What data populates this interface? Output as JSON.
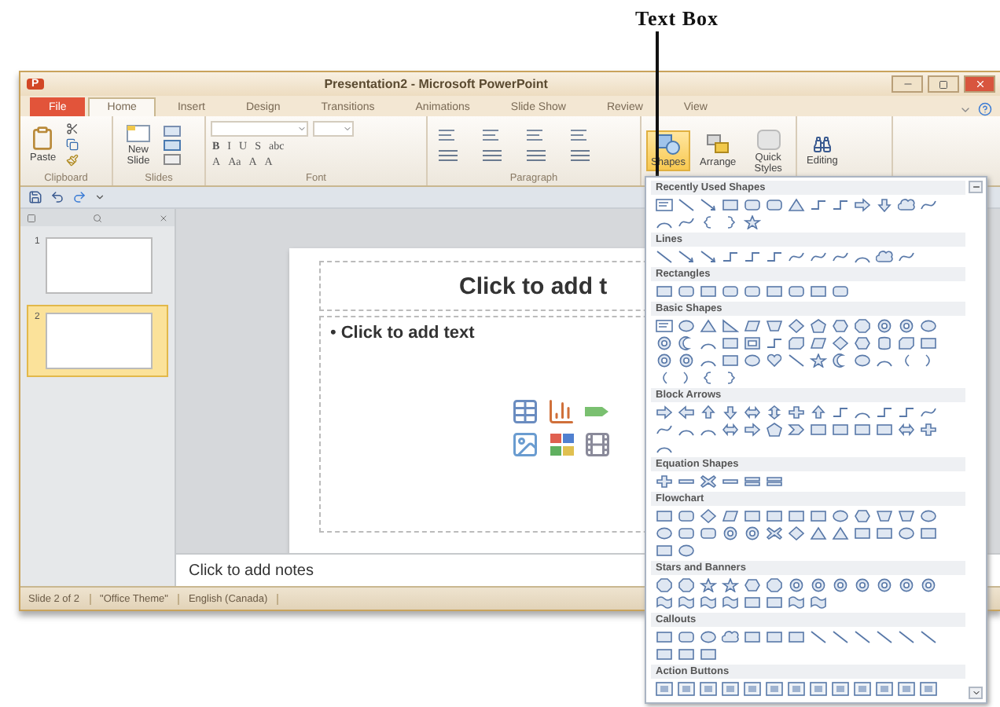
{
  "annotation": {
    "label": "Text Box"
  },
  "window": {
    "app_icon": "P",
    "title": "Presentation2 - Microsoft PowerPoint"
  },
  "tabs": [
    {
      "label": "File",
      "kind": "file",
      "selected": false
    },
    {
      "label": "Home",
      "kind": "tab",
      "selected": true
    },
    {
      "label": "Insert",
      "kind": "tab",
      "selected": false
    },
    {
      "label": "Design",
      "kind": "tab",
      "selected": false
    },
    {
      "label": "Transitions",
      "kind": "tab",
      "selected": false
    },
    {
      "label": "Animations",
      "kind": "tab",
      "selected": false
    },
    {
      "label": "Slide Show",
      "kind": "tab",
      "selected": false
    },
    {
      "label": "Review",
      "kind": "tab",
      "selected": false
    },
    {
      "label": "View",
      "kind": "tab",
      "selected": false
    }
  ],
  "ribbon": {
    "clipboard": {
      "label": "Clipboard",
      "paste": "Paste"
    },
    "slides": {
      "label": "Slides",
      "new_slide": "New Slide"
    },
    "font": {
      "label": "Font",
      "row1": [
        "B",
        "I",
        "U",
        "S",
        "abc"
      ],
      "row2": [
        "A",
        "Aa",
        "A",
        "A"
      ]
    },
    "paragraph": {
      "label": "Paragraph"
    },
    "drawing": [
      {
        "label": "Shapes",
        "selected": true
      },
      {
        "label": "Arrange",
        "selected": false
      },
      {
        "label": "Quick Styles",
        "selected": false
      }
    ],
    "editing": {
      "label": "Editing"
    }
  },
  "thumbnails": [
    {
      "number": "1",
      "selected": false
    },
    {
      "number": "2",
      "selected": true
    }
  ],
  "slide": {
    "title_placeholder": "Click to add t",
    "bullet": "•",
    "body_placeholder": "Click to add text"
  },
  "notes": {
    "placeholder": "Click to add notes"
  },
  "status_bar": [
    "Slide 2 of 2",
    "\"Office Theme\"",
    "English (Canada)"
  ],
  "shapes_menu": {
    "sections": [
      {
        "title": "Recently Used Shapes"
      },
      {
        "title": "Lines"
      },
      {
        "title": "Rectangles"
      },
      {
        "title": "Basic Shapes"
      },
      {
        "title": "Block Arrows"
      },
      {
        "title": "Equation Shapes"
      },
      {
        "title": "Flowchart"
      },
      {
        "title": "Stars and Banners"
      },
      {
        "title": "Callouts"
      },
      {
        "title": "Action Buttons"
      }
    ]
  }
}
